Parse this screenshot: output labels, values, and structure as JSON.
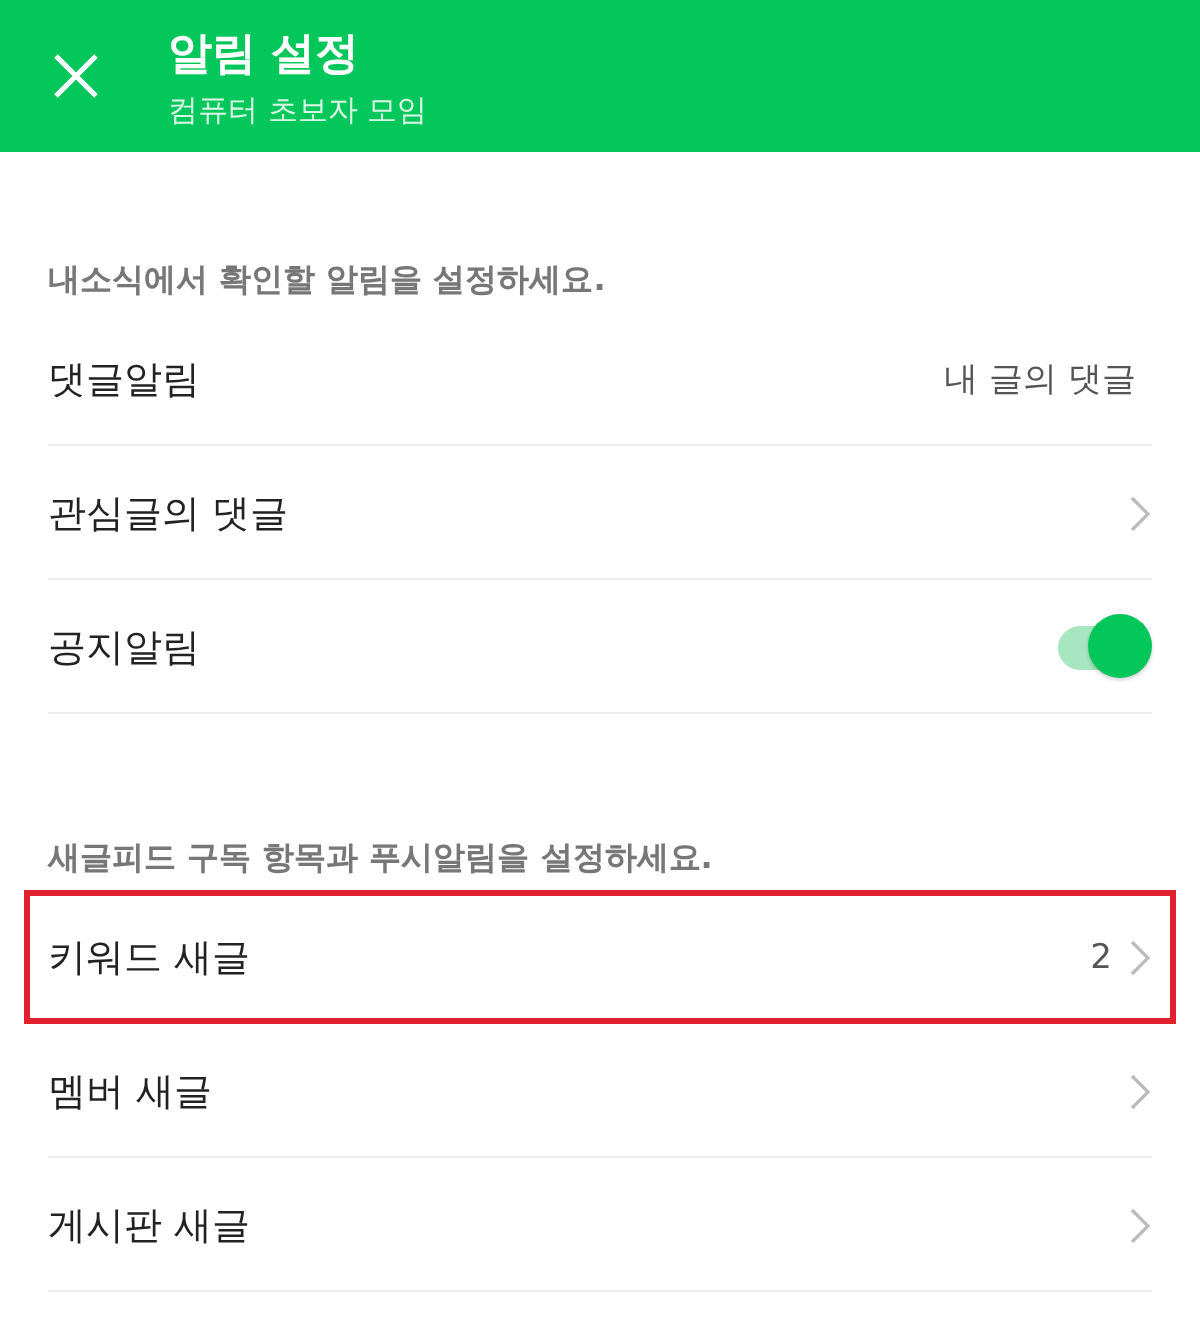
{
  "header": {
    "title": "알림 설정",
    "subtitle": "컴퓨터 초보자 모임"
  },
  "sections": [
    {
      "caption": "내소식에서 확인할 알림을 설정하세요.",
      "items": [
        {
          "kind": "value",
          "label": "댓글알림",
          "value": "내 글의 댓글",
          "highlighted": false
        },
        {
          "kind": "chevron",
          "label": "관심글의 댓글",
          "highlighted": false
        },
        {
          "kind": "toggle",
          "label": "공지알림",
          "on": true,
          "highlighted": false
        }
      ]
    },
    {
      "caption": "새글피드 구독 항목과 푸시알림을 설정하세요.",
      "items": [
        {
          "kind": "chevron",
          "label": "키워드 새글",
          "value": "2",
          "highlighted": true
        },
        {
          "kind": "chevron",
          "label": "멤버 새글",
          "highlighted": false
        },
        {
          "kind": "chevron",
          "label": "게시판 새글",
          "highlighted": false
        }
      ]
    }
  ]
}
